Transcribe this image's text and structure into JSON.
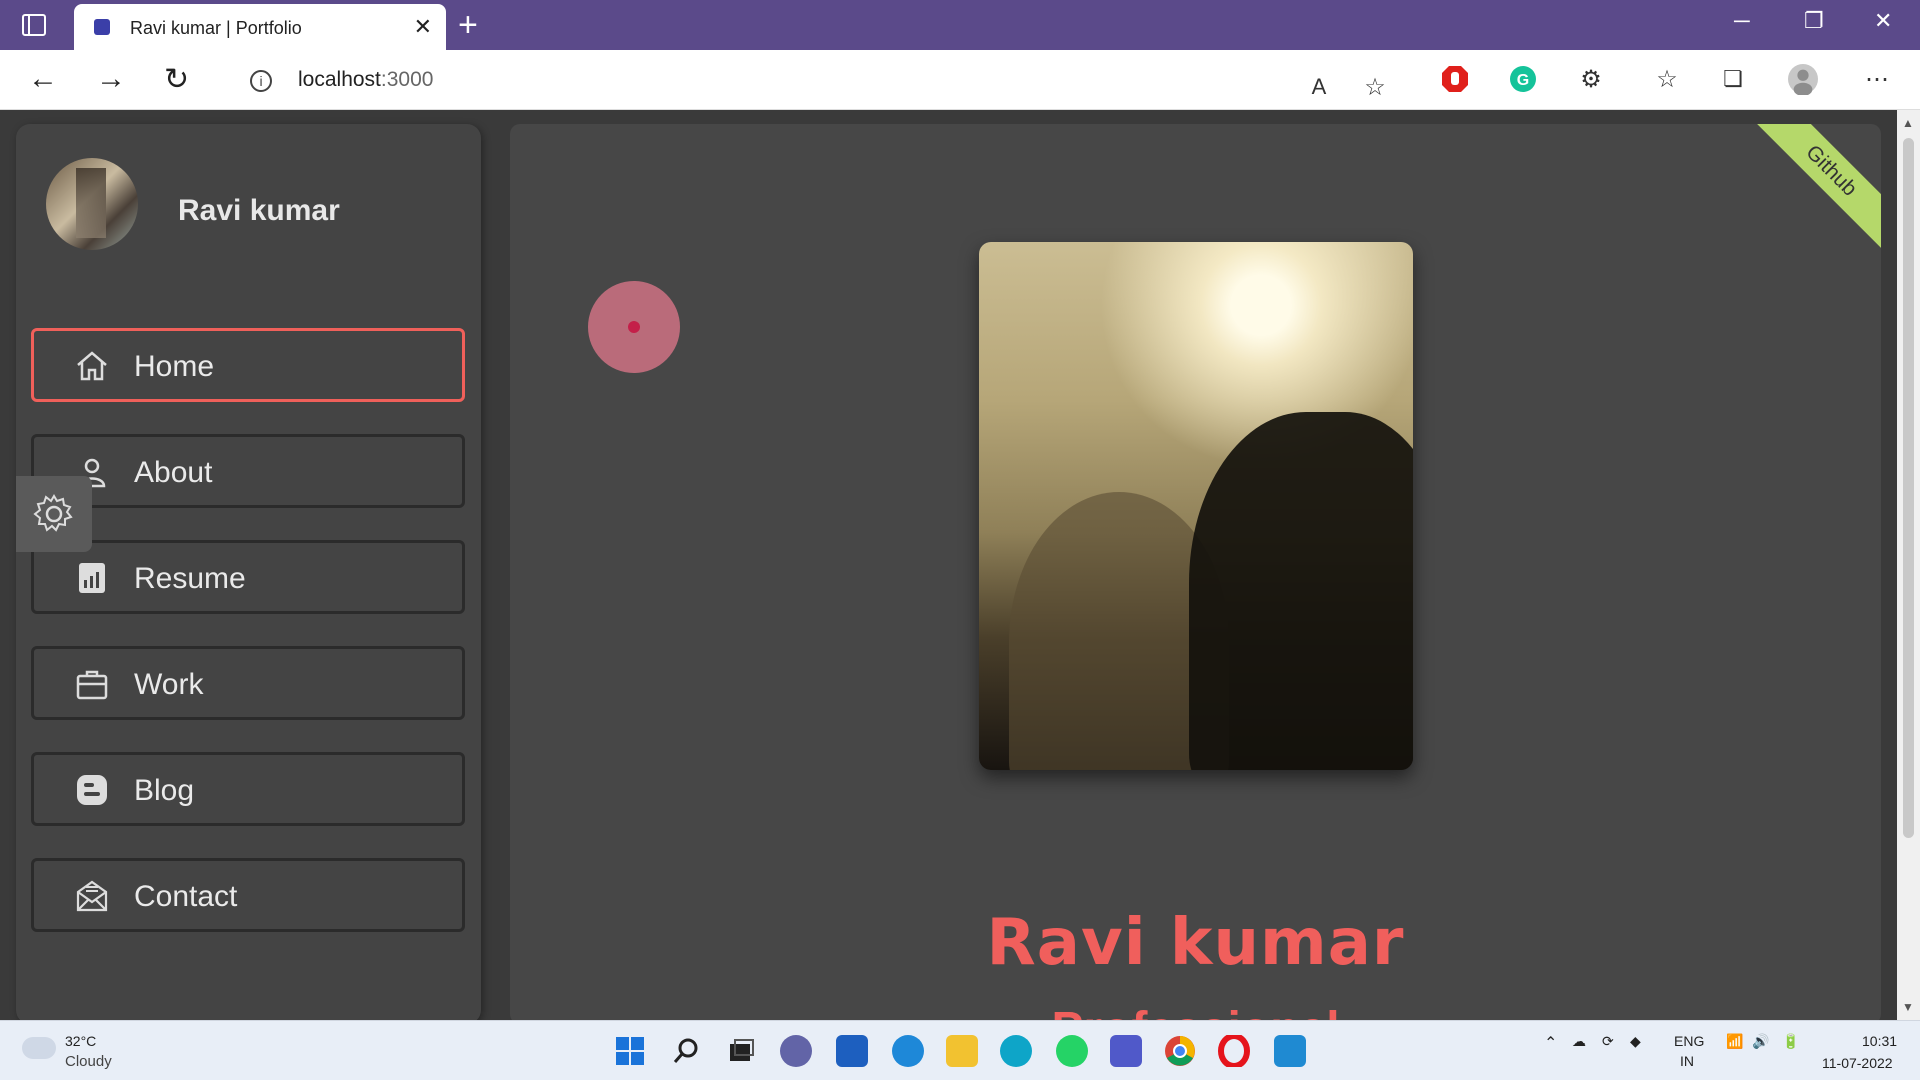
{
  "browser": {
    "tab_title": "Ravi kumar | Portfolio",
    "close_glyph": "✕",
    "new_tab_glyph": "+",
    "url_host": "localhost",
    "url_port": ":3000"
  },
  "sidebar": {
    "profile_name": "Ravi kumar",
    "items": [
      {
        "label": "Home",
        "icon": "home-icon",
        "active": true
      },
      {
        "label": "About",
        "icon": "user-icon",
        "active": false
      },
      {
        "label": "Resume",
        "icon": "chart-icon",
        "active": false
      },
      {
        "label": "Work",
        "icon": "briefcase-icon",
        "active": false
      },
      {
        "label": "Blog",
        "icon": "blogger-icon",
        "active": false
      },
      {
        "label": "Contact",
        "icon": "mail-icon",
        "active": false
      }
    ]
  },
  "main": {
    "hero_name": "Ravi kumar",
    "hero_subtitle_partial": "Professional",
    "ribbon_label": "Github"
  },
  "taskbar": {
    "temperature": "32°C",
    "weather": "Cloudy",
    "lang_top": "ENG",
    "lang_bottom": "IN",
    "time": "10:31",
    "date": "11-07-2022"
  },
  "colors": {
    "accent": "#f05f5c",
    "ribbon": "#b5d86a",
    "titlebar": "#5b4a8a"
  }
}
